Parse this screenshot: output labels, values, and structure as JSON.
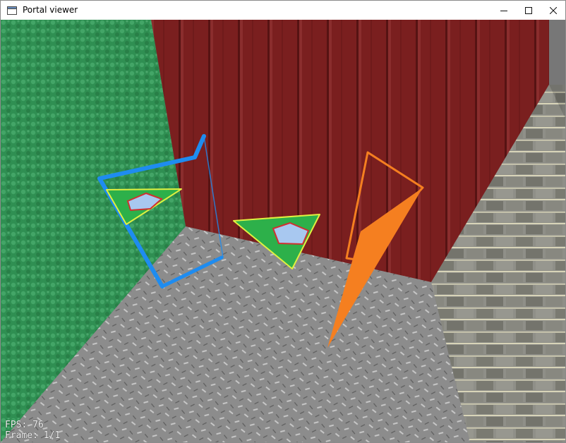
{
  "window": {
    "title": "Portal viewer",
    "icon": "app-window-icon",
    "controls": {
      "minimize_icon": "minimize-icon",
      "maximize_icon": "maximize-icon",
      "close_icon": "close-icon"
    }
  },
  "scene": {
    "left_wall_color": "#2f8f52",
    "back_wall_color": "#7a1f1f",
    "right_wall_color": "#8f8f88",
    "floor_color": "#8c8c8c",
    "portal_a_color": "#1e8cf0",
    "portal_b_color": "#f57f20",
    "marker_fill_color": "#2db04a",
    "marker_outline_color": "#e0f040",
    "marker_inner_color": "#a8c8f0",
    "marker_inner_outline_color": "#d03030"
  },
  "hud": {
    "fps": "FPS: 76",
    "frame": "Frame: 1/1"
  }
}
